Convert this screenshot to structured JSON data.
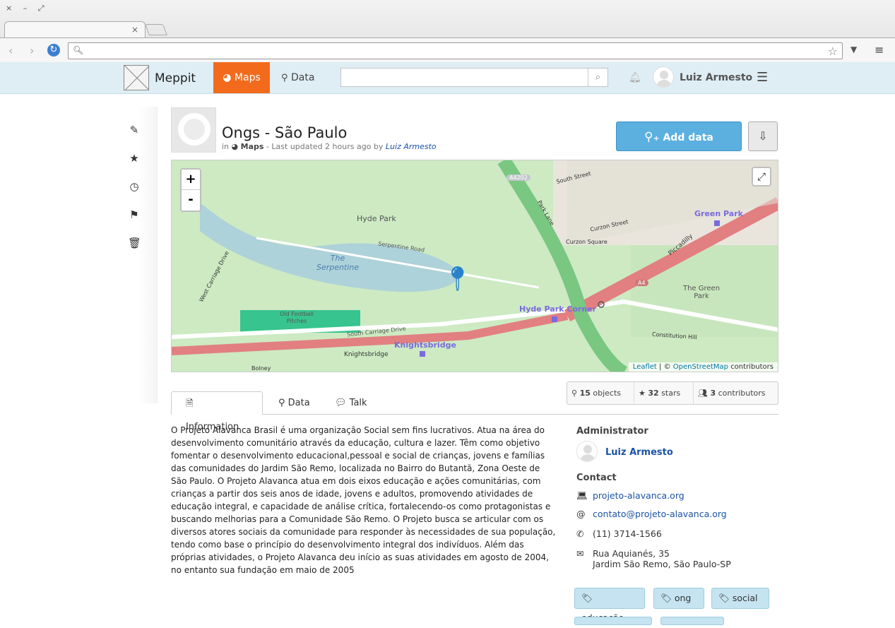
{
  "browser": {
    "tab_close": "×",
    "window_controls": "× – ⤢",
    "url": ""
  },
  "app": {
    "brand": "Meppit",
    "nav": {
      "maps": "Maps",
      "data": "Data"
    },
    "search_placeholder": "",
    "user": "Luiz Armesto"
  },
  "map_page": {
    "title": "Ongs - São Paulo",
    "meta": {
      "prefix": "in",
      "section": "Maps",
      "updated": "- Last updated 2 hours ago by",
      "author": "Luiz Armesto"
    },
    "add_data_label": "Add data",
    "attribution": {
      "leaflet": "Leaflet",
      "sep": "| ©",
      "osm": "OpenStreetMap",
      "suffix": "contributors"
    },
    "map_labels": {
      "hyde_park": "Hyde Park",
      "serpentine_road": "Serpentine Road",
      "the_serpentine": "The Serpentine",
      "old_football": "Old Football Pitches",
      "south_carriage": "South Carriage Drive",
      "knightsbridge_road": "Knightsbridge",
      "knightsbridge": "Knightsbridge",
      "hyde_park_corner": "Hyde Park Corner",
      "green_park_station": "Green Park",
      "the_green_park": "The Green Park",
      "curzon_street": "Curzon Street",
      "curzon_square": "Curzon Square",
      "park_lane": "Park Lane",
      "piccadilly": "Piccadilly",
      "constitution_hill": "Constitution Hill",
      "a4202": "A4202",
      "a4": "A4",
      "south_street": "South Street",
      "west_carriage": "West Carriage Drive",
      "bolney": "Bolney"
    },
    "stats": {
      "objects": "15",
      "objects_label": "objects",
      "stars": "32",
      "stars_label": "stars",
      "contributors": "3",
      "contributors_label": "contributors"
    },
    "tabs": [
      "Information",
      "Data",
      "Talk"
    ],
    "description": "O Projeto Alavanca Brasil é uma organização Social sem fins lucrativos. Atua na área do desenvolvimento comunitário através da educação, cultura e lazer. Têm como objetivo fomentar o desenvolvimento educacional,pessoal e social de crianças, jovens e famílias das comunidades do Jardim São Remo, localizada no Bairro do Butantã, Zona Oeste de São Paulo. O Projeto Alavanca atua em dois eixos educação e ações comunitárias, com crianças a partir dos seis anos de idade, jovens e adultos, promovendo atividades de educação integral, e capacidade de análise crítica, fortalecendo-os como protagonistas e buscando melhorias para a Comunidade São Remo. O Projeto busca se articular com os diversos atores sociais da comunidade para responder às necessidades de sua população, tendo como base o princípio do desenvolvimento integral dos indivíduos. Além das próprias atividades, o Projeto Alavanca deu início as suas atividades em agosto de 2004, no entanto sua fundação em maio de 2005",
    "administrator_heading": "Administrator",
    "administrator": "Luiz Armesto",
    "contact_heading": "Contact",
    "contact": {
      "website": "projeto-alavanca.org",
      "email": "contato@projeto-alavanca.org",
      "phone": "(11) 3714-1566",
      "address_line1": "Rua Aquianés, 35",
      "address_line2": "Jardim São Remo, São Paulo-SP"
    },
    "tags": [
      "educação",
      "ong",
      "social"
    ]
  },
  "colors": {
    "accent": "#f26b1d",
    "primary_button": "#5bb0e0",
    "link": "#1b53a5",
    "appbar": "#dfeef5",
    "tag": "#c5e3f0"
  }
}
